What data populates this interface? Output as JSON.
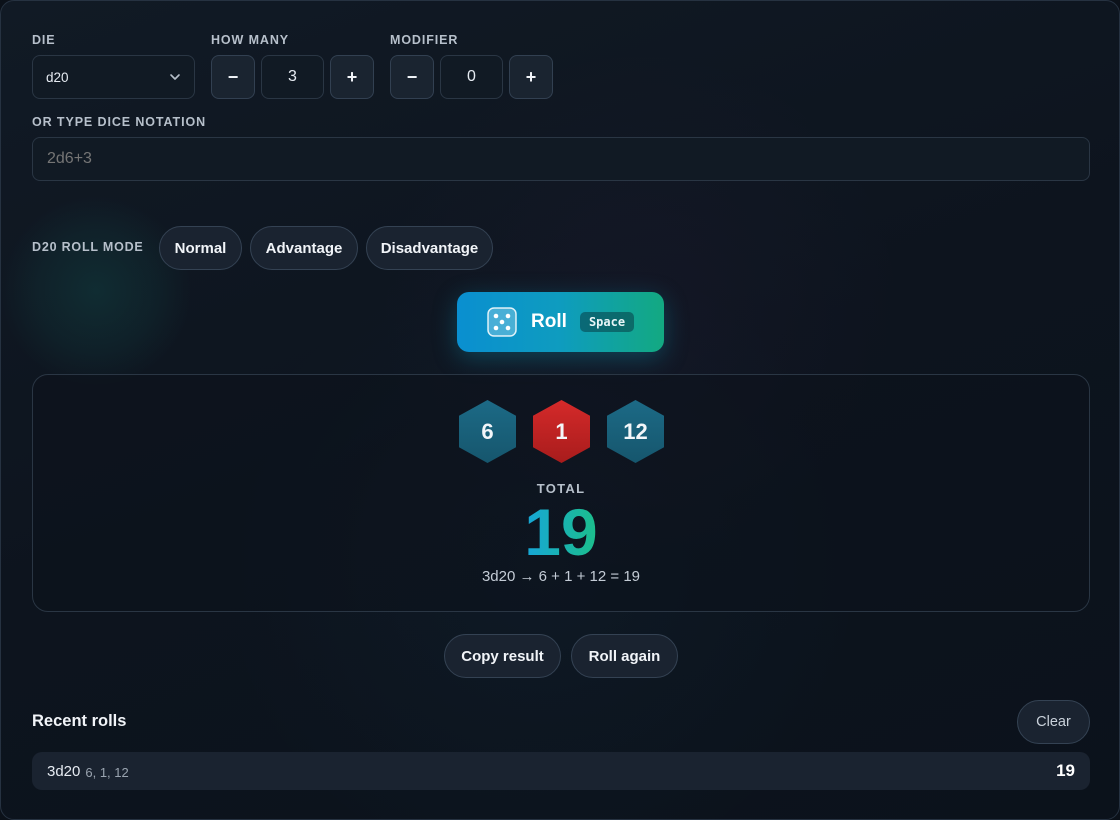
{
  "die": {
    "label": "DIE",
    "value": "d20"
  },
  "how_many": {
    "label": "HOW MANY",
    "minus": "−",
    "value": "3",
    "plus": "+"
  },
  "modifier": {
    "label": "MODIFIER",
    "minus": "−",
    "value": "0",
    "plus": "+"
  },
  "notation": {
    "label": "OR TYPE DICE NOTATION",
    "placeholder": "2d6+3",
    "value": ""
  },
  "roll_mode": {
    "label": "D20 ROLL MODE",
    "options": [
      "Normal",
      "Advantage",
      "Disadvantage"
    ],
    "selected": "Normal"
  },
  "roll_button": {
    "label": "Roll",
    "shortcut": "Space",
    "icon": "dice-icon"
  },
  "result": {
    "dice": [
      {
        "value": "6",
        "color": "#1c6a86"
      },
      {
        "value": "1",
        "color": "#d52a2a"
      },
      {
        "value": "12",
        "color": "#1c6a86"
      }
    ],
    "total_label": "TOTAL",
    "total": "19",
    "breakdown": "3d20 → 6 + 1 + 12 = 19"
  },
  "actions": {
    "copy": "Copy result",
    "again": "Roll again"
  },
  "recent": {
    "title": "Recent rolls",
    "clear": "Clear",
    "items": [
      {
        "notation": "3d20",
        "values": "6, 1, 12",
        "total": "19"
      }
    ]
  },
  "colors": {
    "accent_start": "#0a8fd0",
    "accent_end": "#13a981",
    "background": "#0b1119"
  }
}
